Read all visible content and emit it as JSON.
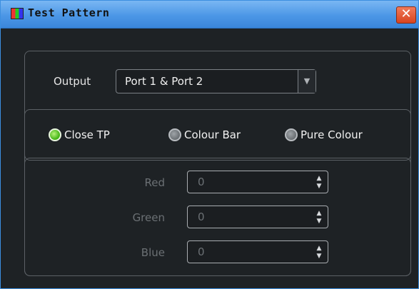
{
  "window": {
    "title": "Test Pattern",
    "close_glyph": "✕"
  },
  "output": {
    "label": "Output",
    "selected": "Port 1 & Port 2"
  },
  "radios": [
    {
      "label": "Close TP",
      "checked": true
    },
    {
      "label": "Colour Bar",
      "checked": false
    },
    {
      "label": "Pure Colour",
      "checked": false
    }
  ],
  "colors": [
    {
      "label": "Red",
      "value": "0"
    },
    {
      "label": "Green",
      "value": "0"
    },
    {
      "label": "Blue",
      "value": "0"
    }
  ],
  "theme": {
    "titlebar": "#4c97e6",
    "background": "#1e2225",
    "close": "#d8441f",
    "radio_on": "#44b516"
  }
}
